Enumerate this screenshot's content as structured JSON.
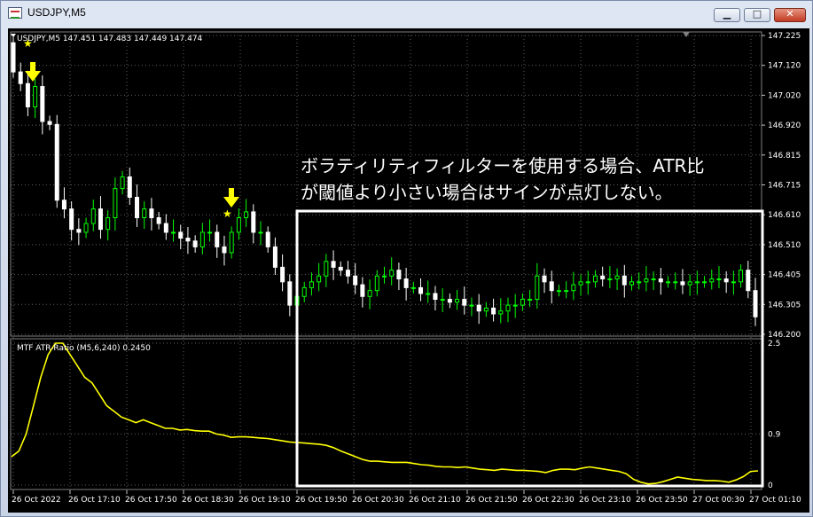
{
  "window": {
    "title": "USDJPY,M5",
    "minimize_glyph": "▁",
    "maximize_glyph": "□",
    "close_glyph": "✕"
  },
  "chart": {
    "header": "USDJPY,M5  147.451 147.483 147.449 147.474",
    "indicator_label": "MTF ATR-Ratio (M5,6,240) 0.2450",
    "annotation_line1": "ボラティリティフィルターを使用する場合、ATR比",
    "annotation_line2": "が閾値より小さい場合はサインが点灯しない。",
    "price_axis": [
      "147.225",
      "147.120",
      "147.020",
      "146.920",
      "146.815",
      "146.715",
      "146.610",
      "146.510",
      "146.405",
      "146.305",
      "146.200"
    ],
    "indicator_axis": [
      "2.5",
      "0.9",
      "0"
    ],
    "time_axis": [
      "26 Oct 2022",
      "26 Oct 17:10",
      "26 Oct 17:50",
      "26 Oct 18:30",
      "26 Oct 19:10",
      "26 Oct 19:50",
      "26 Oct 20:30",
      "26 Oct 21:10",
      "26 Oct 21:50",
      "26 Oct 22:30",
      "26 Oct 23:10",
      "26 Oct 23:50",
      "27 Oct 00:30",
      "27 Oct 01:10"
    ],
    "colors": {
      "bull": "#00ff00",
      "bear": "#ffffff",
      "indicator": "#ffff00",
      "arrow": "#ffff00",
      "grid": "#c0c0c0",
      "highlight": "#ffffff"
    },
    "signal_arrows": [
      "down-arrow-icon",
      "down-arrow-icon"
    ]
  },
  "chart_data": {
    "type": "candlestick",
    "y_range": [
      146.2,
      147.225
    ],
    "candles_close": [
      147.1,
      147.06,
      146.98,
      147.05,
      146.93,
      146.92,
      146.66,
      146.63,
      146.56,
      146.55,
      146.58,
      146.63,
      146.56,
      146.6,
      146.7,
      146.74,
      146.67,
      146.6,
      146.63,
      146.6,
      146.58,
      146.55,
      146.55,
      146.53,
      146.52,
      146.5,
      146.55,
      146.55,
      146.5,
      146.48,
      146.55,
      146.6,
      146.62,
      146.55,
      146.55,
      146.5,
      146.43,
      146.38,
      146.3,
      146.33,
      146.36,
      146.38,
      146.4,
      146.45,
      146.43,
      146.42,
      146.4,
      146.37,
      146.33,
      146.35,
      146.4,
      146.4,
      146.42,
      146.39,
      146.36,
      146.36,
      146.34,
      146.34,
      146.32,
      146.32,
      146.31,
      146.32,
      146.3,
      146.3,
      146.28,
      146.29,
      146.27,
      146.28,
      146.3,
      146.3,
      146.32,
      146.32,
      146.4,
      146.38,
      146.35,
      146.35,
      146.35,
      146.37,
      146.38,
      146.38,
      146.4,
      146.39,
      146.39,
      146.4,
      146.37,
      146.38,
      146.38,
      146.39,
      146.39,
      146.38,
      146.38,
      146.38,
      146.37,
      146.38,
      146.38,
      146.38,
      146.39,
      146.39,
      146.38,
      146.38,
      146.42,
      146.35,
      146.26
    ],
    "indicator_values": [
      0.5,
      0.6,
      0.9,
      1.4,
      1.9,
      2.3,
      2.5,
      2.5,
      2.3,
      2.1,
      1.9,
      1.8,
      1.6,
      1.4,
      1.3,
      1.2,
      1.15,
      1.1,
      1.15,
      1.1,
      1.05,
      1.0,
      1.0,
      0.97,
      0.98,
      0.96,
      0.95,
      0.95,
      0.9,
      0.88,
      0.84,
      0.85,
      0.85,
      0.84,
      0.83,
      0.82,
      0.8,
      0.78,
      0.76,
      0.75,
      0.74,
      0.73,
      0.72,
      0.7,
      0.66,
      0.6,
      0.55,
      0.5,
      0.45,
      0.42,
      0.42,
      0.41,
      0.4,
      0.4,
      0.4,
      0.38,
      0.36,
      0.35,
      0.33,
      0.32,
      0.32,
      0.31,
      0.32,
      0.3,
      0.28,
      0.27,
      0.26,
      0.28,
      0.27,
      0.26,
      0.26,
      0.25,
      0.24,
      0.22,
      0.26,
      0.28,
      0.28,
      0.27,
      0.3,
      0.32,
      0.3,
      0.28,
      0.26,
      0.24,
      0.2,
      0.1,
      0.05,
      0.02,
      0.03,
      0.06,
      0.1,
      0.14,
      0.12,
      0.1,
      0.09,
      0.08,
      0.08,
      0.07,
      0.05,
      0.09,
      0.15,
      0.24,
      0.25
    ],
    "indicator_range": [
      0,
      2.5
    ]
  }
}
